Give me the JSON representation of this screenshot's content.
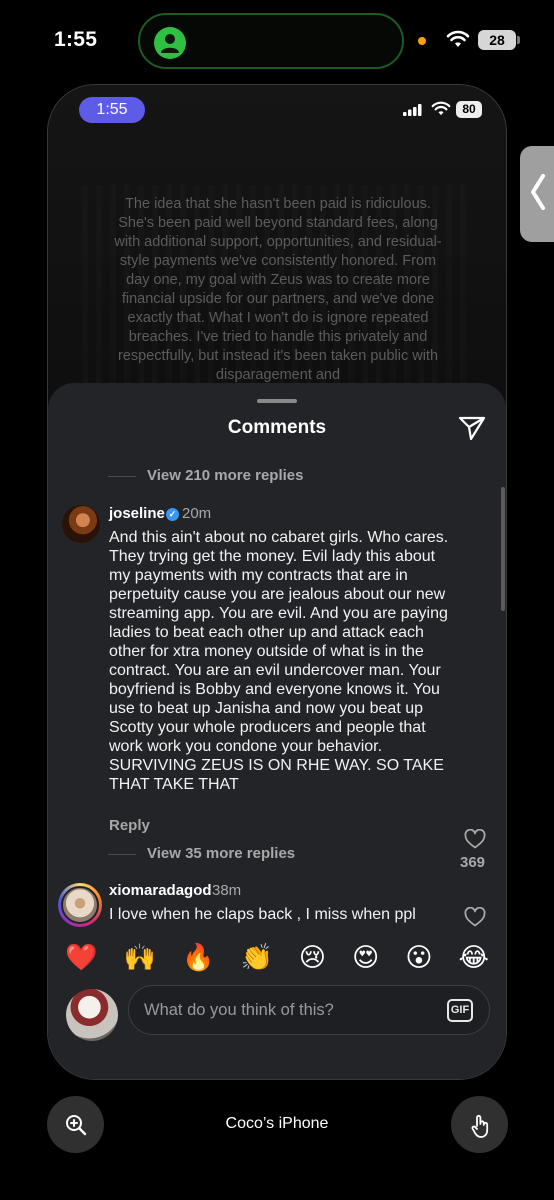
{
  "outer_status": {
    "time": "1:55",
    "battery": "28"
  },
  "phone_status": {
    "time": "1:55",
    "battery": "80"
  },
  "post": {
    "caption": "The idea that she hasn't been paid is ridiculous. She's been paid well beyond standard fees, along with additional support, opportunities, and residual-style payments we've consistently honored. From day one, my goal with Zeus was to create more financial upside for our partners, and we've done exactly that. What I won't do is ignore repeated breaches. I've tried to handle this privately and respectfully, but instead it's been taken public with disparagement and"
  },
  "comments_sheet": {
    "title": "Comments",
    "view_more_top": "View 210 more replies",
    "comment1": {
      "username": "joseline",
      "verified": true,
      "time": "20m",
      "text": "And this ain't about no cabaret girls. Who cares. They trying get the money. Evil lady this about my payments with my contracts that are in perpetuity cause you are jealous about our new streaming app. You are evil. And you are paying ladies to beat each other up and attack each other for xtra money outside of what is in the contract. You are an evil undercover man. Your boyfriend is Bobby and everyone knows it. You use to beat up Janisha and now you beat up Scotty your whole producers and people that work work you condone your behavior. SURVIVING ZEUS IS ON RHE WAY. SO TAKE THAT TAKE THAT",
      "likes": "369",
      "reply_label": "Reply"
    },
    "view_more_mid": "View 35 more replies",
    "comment2": {
      "username": "xiomaradagod",
      "time": "38m",
      "text": "I love when he claps back , I miss when ppl"
    },
    "emojis": [
      "❤️",
      "🙌",
      "🔥",
      "👏",
      "😢",
      "😍",
      "😮",
      "😂"
    ],
    "input": {
      "placeholder": "What do you think of this?",
      "gif_label": "GIF"
    }
  },
  "bottom_bar": {
    "device_name": "Coco’s iPhone"
  },
  "colors": {
    "sheet": "#232427",
    "accent_purple": "#5e5ce6",
    "verified_blue": "#3897f0",
    "island_green": "#2fbf42"
  }
}
